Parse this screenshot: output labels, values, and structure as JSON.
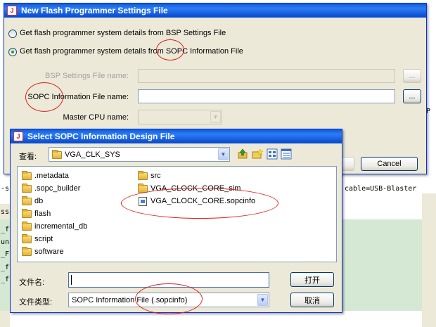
{
  "settings_dialog": {
    "title": "New Flash Programmer Settings File",
    "radio_bsp": "Get flash programmer system details from BSP Settings File",
    "radio_sopc": "Get flash programmer system details from SOPC Information File",
    "bsp_label": "BSP Settings File name:",
    "sopc_label": "SOPC Information File name:",
    "browse_label": "...",
    "master_cpu_label": "Master CPU name:",
    "cancel_label": "Cancel"
  },
  "open_dialog": {
    "title": "Select SOPC Information Design File",
    "look_in_label": "查看:",
    "look_in_value": "VGA_CLK_SYS",
    "files_col1": [
      ".metadata",
      ".sopc_builder",
      "db",
      "flash",
      "incremental_db",
      "script",
      "software"
    ],
    "files_col2": [
      "src",
      "VGA_CLOCK_CORE_sim",
      "VGA_CLOCK_CORE.sopcinfo"
    ],
    "filename_label": "文件名:",
    "filename_value": "",
    "filetype_label": "文件类型:",
    "filetype_value": "SOPC Information File (.sopcinfo)",
    "open_label": "打开",
    "cancel_label": "取消"
  },
  "background": {
    "cmd_left": "-s",
    "cmd_right": "cable=USB-Blaster",
    "left_fragments": [
      "ssi",
      "_fl",
      "un",
      "_Fl",
      "_fl",
      "_fl"
    ],
    "right_fragment": "P"
  },
  "colors": {
    "title_blue": "#0a5ddb",
    "annotation_red": "#e0201a",
    "dialog_face": "#ece9d8",
    "console_green": "#d4e8d4"
  }
}
